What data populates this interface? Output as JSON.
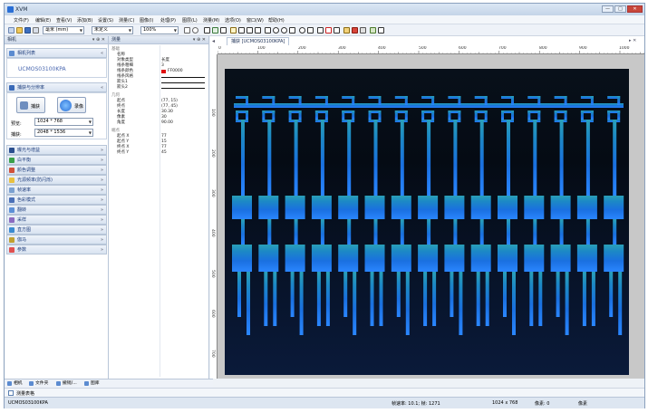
{
  "window": {
    "title": "XVM",
    "minimize": "—",
    "maximize": "□",
    "close": "✕"
  },
  "menu": [
    "文件(F)",
    "编辑(E)",
    "查看(V)",
    "添加(B)",
    "设置(S)",
    "测量(C)",
    "图像(I)",
    "处理(P)",
    "图层(L)",
    "测量(M)",
    "选项(O)",
    "窗口(W)",
    "帮助(H)"
  ],
  "toolbar": {
    "unit": "毫米 (mm)",
    "calibration": "未定义",
    "zoom": "100%"
  },
  "left": {
    "header": "相机",
    "camera_list_title": "相机列表",
    "camera_name": "UCMOS03100KPA",
    "capture_title": "捕获与分辨率",
    "capture_btn": "捕获",
    "record_btn": "录像",
    "preview_label": "预览:",
    "preview_value": "1024 * 768",
    "capture_label": "捕获:",
    "capture_value": "2048 * 1536",
    "sections": [
      "曝光与增益",
      "白平衡",
      "颜色调整",
      "光源频率(防闪烁)",
      "帧速率",
      "色彩模式",
      "翻转",
      "采样",
      "直方图",
      "伽马",
      "参数"
    ]
  },
  "props": {
    "header": "测量",
    "group_basic": "基础",
    "basic": [
      {
        "k": "名称",
        "v": ""
      },
      {
        "k": "对象类型",
        "v": "长度"
      },
      {
        "k": "线条粗细",
        "v": "3"
      },
      {
        "k": "线条颜色",
        "v": "FF0000"
      },
      {
        "k": "线条风格",
        "v": ""
      },
      {
        "k": "箭头1",
        "v": ""
      },
      {
        "k": "箭头2",
        "v": ""
      }
    ],
    "group_geo": "几何",
    "geo": [
      {
        "k": "起点",
        "v": "(77, 15)"
      },
      {
        "k": "终点",
        "v": "(77, 45)"
      },
      {
        "k": "长度",
        "v": "30.30"
      },
      {
        "k": "像素",
        "v": "30"
      },
      {
        "k": "角度",
        "v": "90.00"
      }
    ],
    "group_pts": "端点",
    "pts": [
      {
        "k": "起点 X",
        "v": "77"
      },
      {
        "k": "起点 Y",
        "v": "15"
      },
      {
        "k": "终点 X",
        "v": "77"
      },
      {
        "k": "终点 Y",
        "v": "45"
      }
    ]
  },
  "image": {
    "tab": "捕获 [UCMOS03100KPA]",
    "ruler_top": [
      "0",
      "100",
      "200",
      "300",
      "400",
      "500",
      "600",
      "700",
      "800",
      "900",
      "1000"
    ],
    "ruler_left": [
      "100",
      "200",
      "300",
      "400",
      "500",
      "600",
      "700"
    ]
  },
  "bottom": {
    "tabs": [
      "相机",
      "文件夹",
      "撤销/...",
      "图库"
    ],
    "report": "测量表格"
  },
  "status": {
    "camera": "UCMOS03100KPA",
    "fps": "帧速率: 10.1; 帧: 1271",
    "resolution": "1024 x 768",
    "mode": "像素: 0",
    "unit": "像素"
  }
}
